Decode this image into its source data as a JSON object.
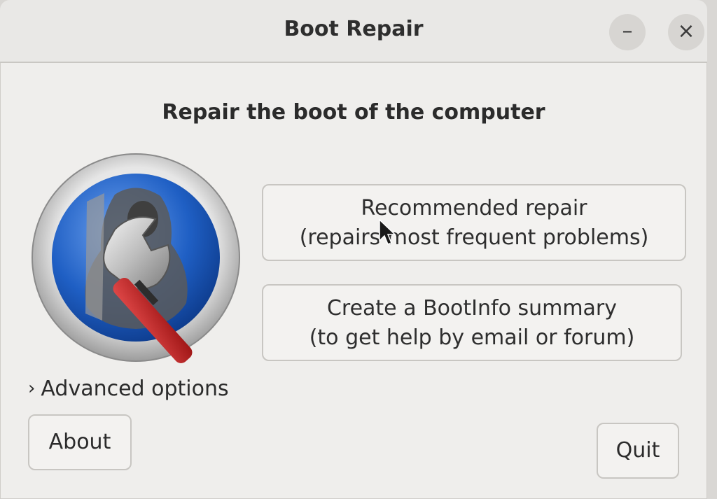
{
  "window": {
    "title": "Boot Repair",
    "minimize_glyph": "–",
    "close_glyph": "×"
  },
  "main": {
    "heading": "Repair the boot of the computer",
    "logo_icon": "boot-repair-wrench-penguin-icon",
    "recommended": {
      "line1": "Recommended repair",
      "line2": "(repairs most frequent problems)"
    },
    "bootinfo": {
      "line1": "Create a BootInfo summary",
      "line2": "(to get help by email or forum)"
    },
    "advanced_label": "Advanced options",
    "advanced_chevron": "›"
  },
  "footer": {
    "about_label": "About",
    "quit_label": "Quit"
  },
  "colors": {
    "window_bg": "#efeeec",
    "button_bg": "#f3f2f0",
    "wrench_handle": "#c62828",
    "logo_blue": "#1f5fc4"
  }
}
